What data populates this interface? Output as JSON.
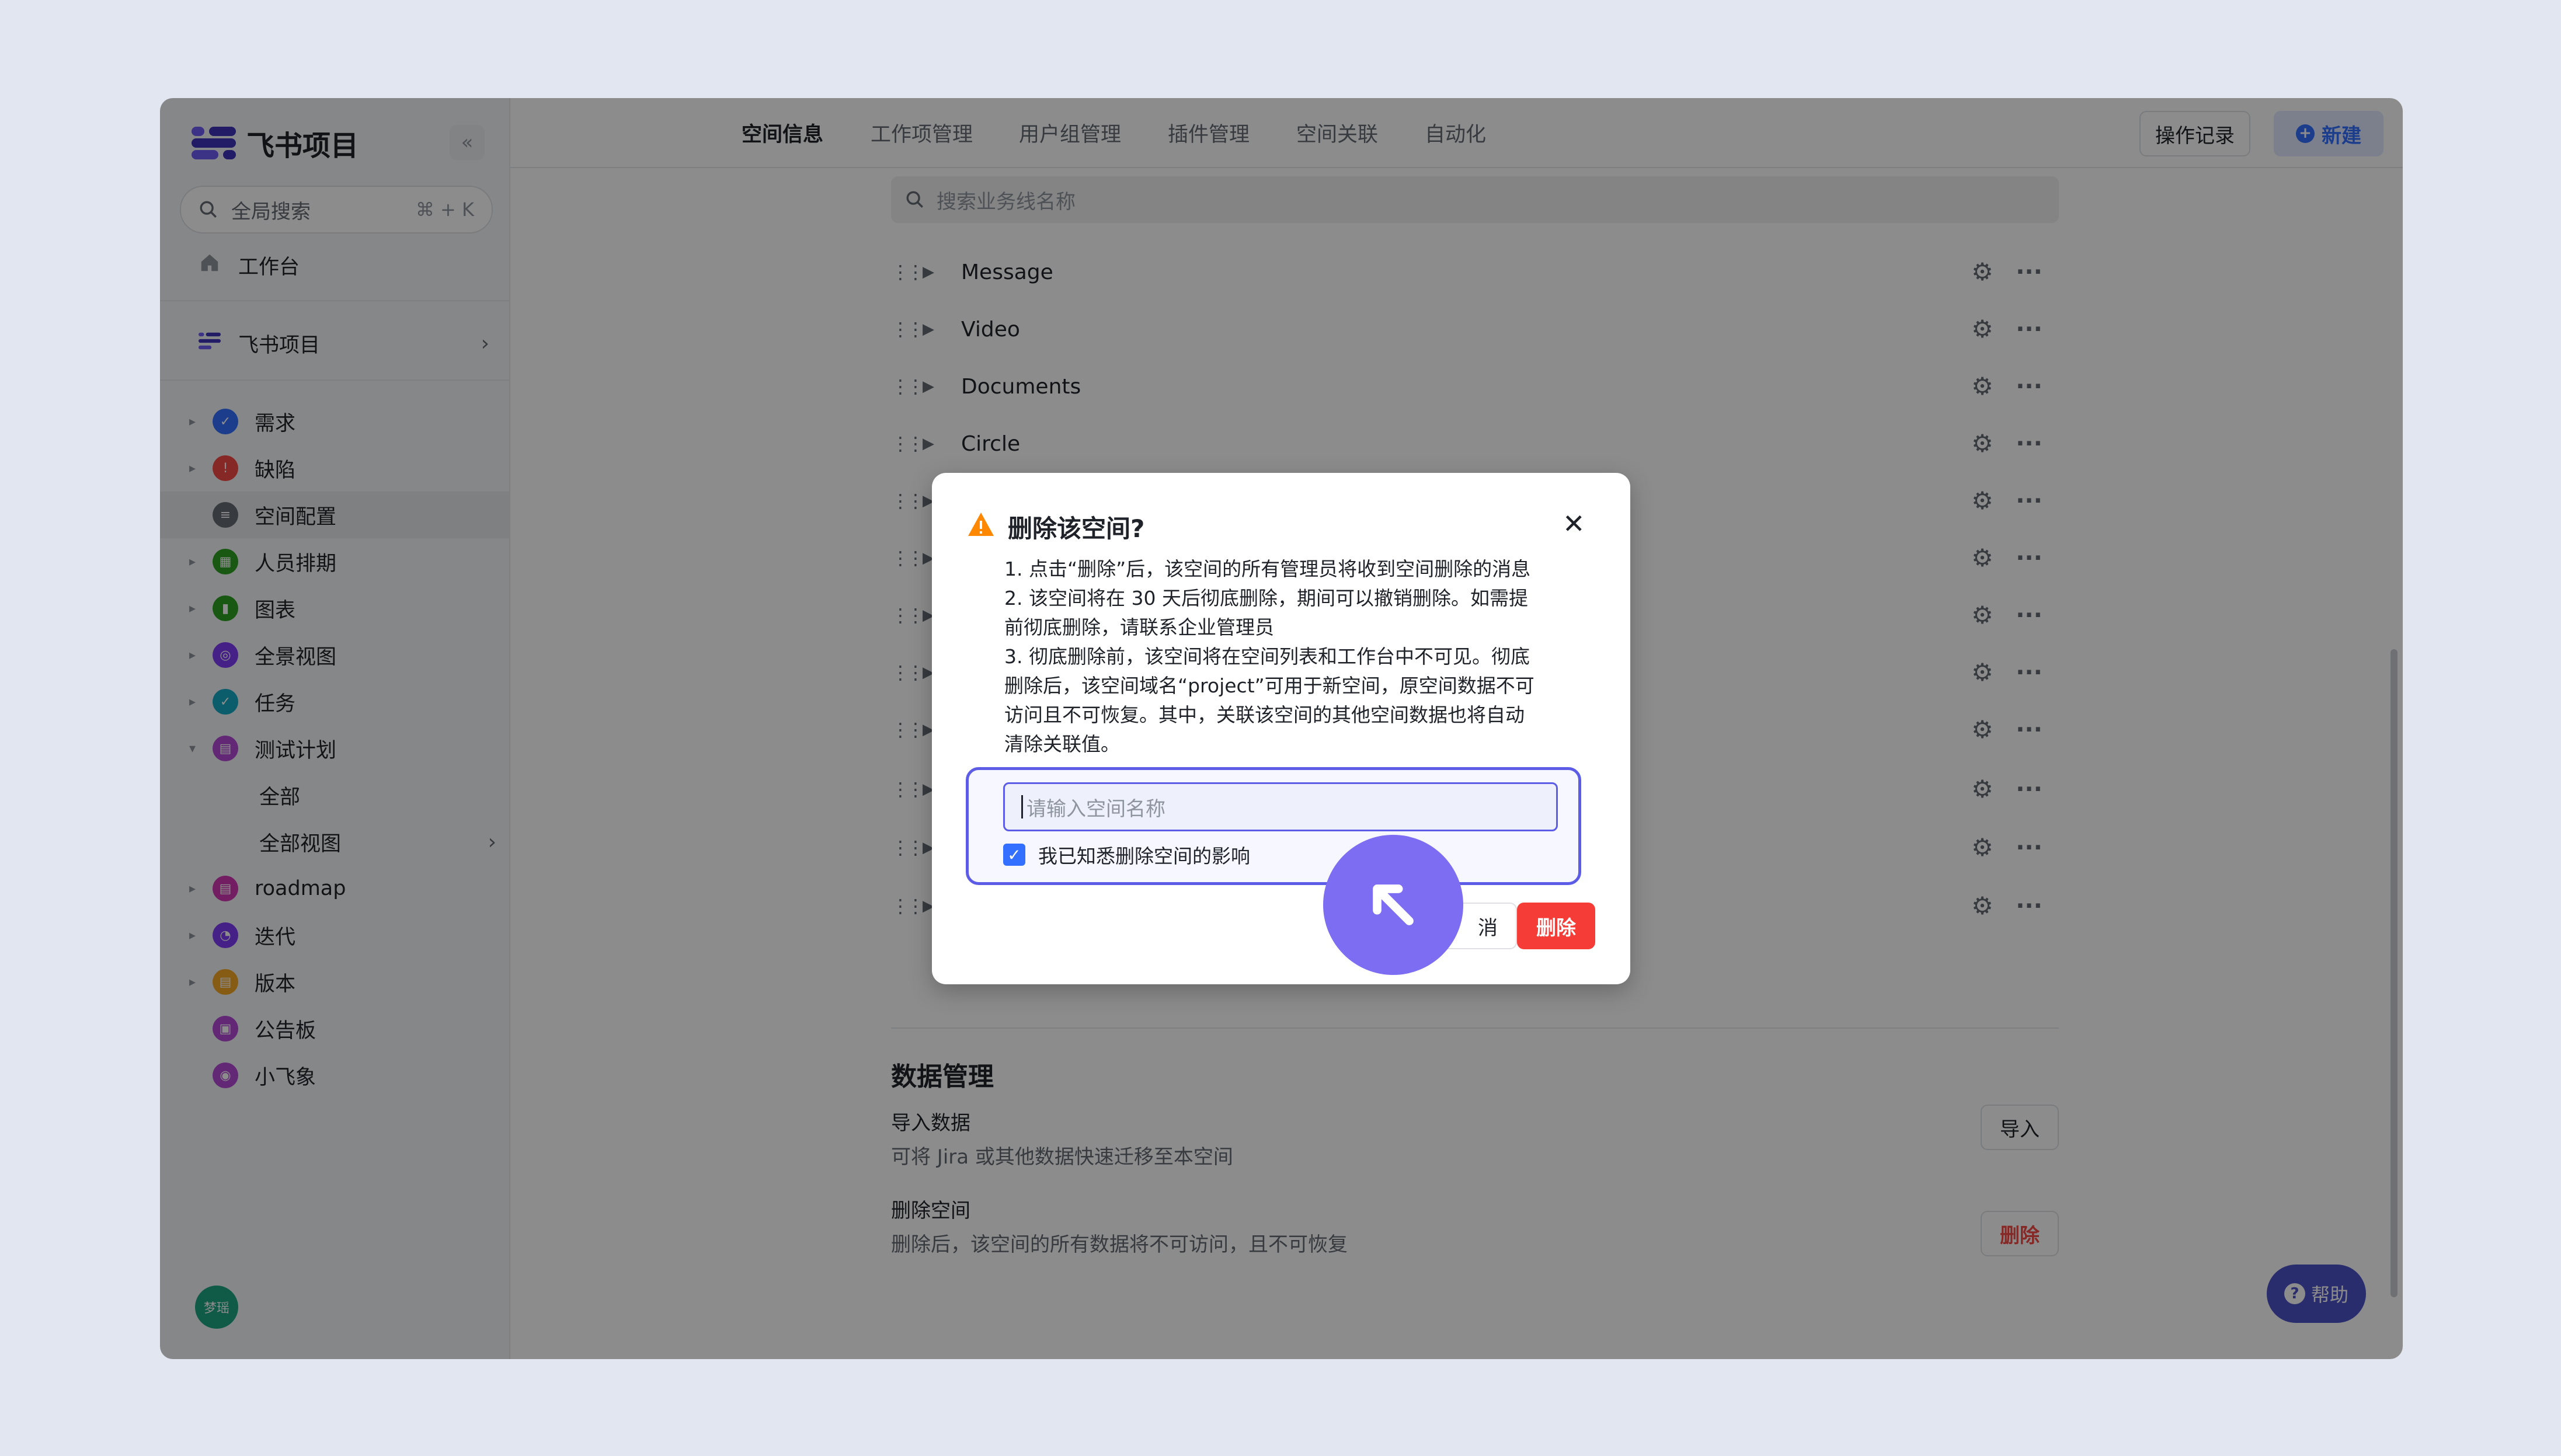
{
  "app": {
    "name": "飞书项目"
  },
  "sidebar": {
    "search_label": "全局搜索",
    "search_shortcut": "⌘ + K",
    "workbench": "工作台",
    "project_switch": "飞书项目",
    "items": [
      {
        "label": "需求",
        "color": "#3370ff"
      },
      {
        "label": "缺陷",
        "color": "#f54a45"
      },
      {
        "label": "空间配置",
        "color": "#646a73"
      },
      {
        "label": "人员排期",
        "color": "#2ea121"
      },
      {
        "label": "图表",
        "color": "#2ea121"
      },
      {
        "label": "全景视图",
        "color": "#7f3bf5"
      },
      {
        "label": "任务",
        "color": "#14a9c4"
      },
      {
        "label": "测试计划",
        "color": "#b34ad6"
      },
      {
        "label": "全部"
      },
      {
        "label": "全部视图"
      },
      {
        "label": "roadmap",
        "color": "#d136b3"
      },
      {
        "label": "迭代",
        "color": "#7f3bf5"
      },
      {
        "label": "版本",
        "color": "#f5a623"
      },
      {
        "label": "公告板",
        "color": "#b34ad6"
      },
      {
        "label": "小飞象",
        "color": "#b34ad6"
      }
    ],
    "avatar_text": "梦瑶"
  },
  "topbar": {
    "tabs": [
      "空间信息",
      "工作项管理",
      "用户组管理",
      "插件管理",
      "空间关联",
      "自动化"
    ],
    "log_button": "操作记录",
    "new_button": "新建"
  },
  "business_lines": {
    "search_placeholder": "搜索业务线名称",
    "rows": [
      "Message",
      "Video",
      "Documents",
      "Circle",
      "",
      "",
      "",
      "",
      "",
      "",
      "",
      ""
    ]
  },
  "data_management": {
    "title": "数据管理",
    "import_title": "导入数据",
    "import_desc": "可将 Jira 或其他数据快速迁移至本空间",
    "import_button": "导入",
    "delete_title": "删除空间",
    "delete_desc": "删除后，该空间的所有数据将不可访问，且不可恢复",
    "delete_button": "删除"
  },
  "help_button": "帮助",
  "dialog": {
    "title": "删除该空间?",
    "body_lines": [
      "1. 点击“删除”后，该空间的所有管理员将收到空间删除的消息",
      "2. 该空间将在 30 天后彻底删除，期间可以撤销删除。如需提",
      "前彻底删除，请联系企业管理员",
      "3. 彻底删除前，该空间将在空间列表和工作台中不可见。彻底",
      "删除后，该空间域名“project”可用于新空间，原空间数据不可",
      "访问且不可恢复。其中，关联该空间的其他空间数据也将自动",
      "清除关联值。"
    ],
    "input_placeholder": "请输入空间名称",
    "checkbox_label": "我已知悉删除空间的影响",
    "cancel_button_visible": "消",
    "delete_button": "删除"
  }
}
